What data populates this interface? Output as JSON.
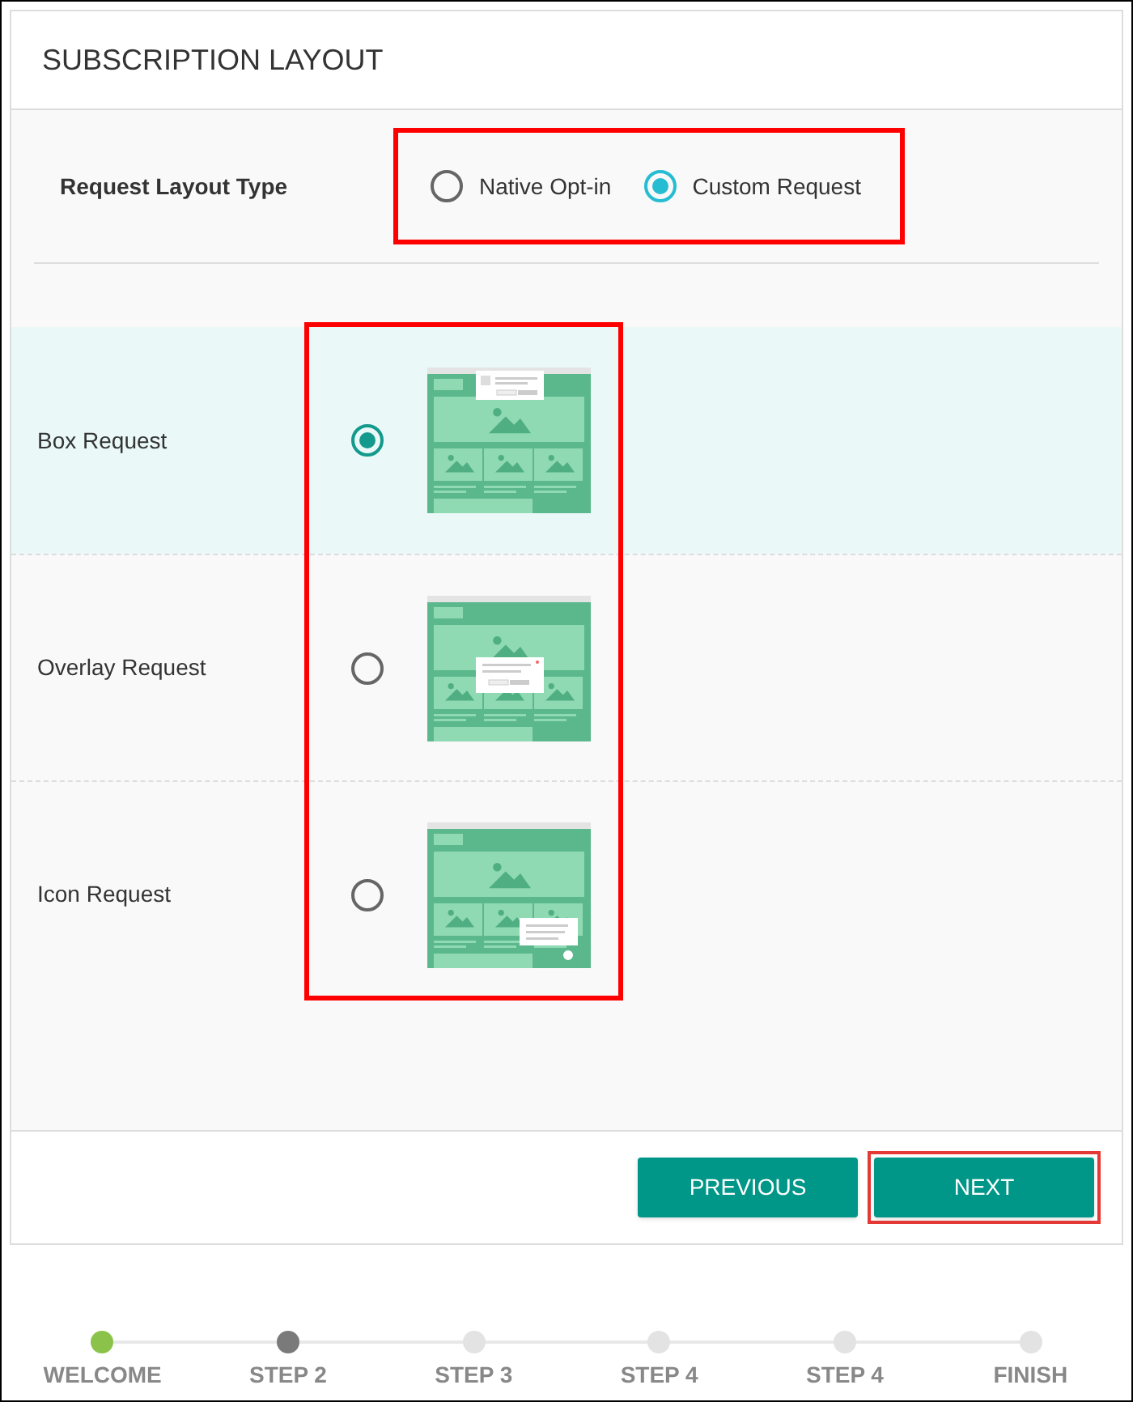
{
  "panel": {
    "title": "SUBSCRIPTION LAYOUT"
  },
  "layout_type": {
    "label": "Request Layout Type",
    "options": [
      {
        "label": "Native Opt-in",
        "selected": false
      },
      {
        "label": "Custom Request",
        "selected": true
      }
    ]
  },
  "requests": [
    {
      "label": "Box Request",
      "kind": "box",
      "selected": true
    },
    {
      "label": "Overlay Request",
      "kind": "overlay",
      "selected": false
    },
    {
      "label": "Icon Request",
      "kind": "icon",
      "selected": false
    }
  ],
  "buttons": [
    {
      "label": "PREVIOUS",
      "highlighted": false
    },
    {
      "label": "NEXT",
      "highlighted": true
    }
  ],
  "steps": [
    {
      "label": "WELCOME",
      "completed": true,
      "current": false
    },
    {
      "label": "STEP 2",
      "completed": false,
      "current": true
    },
    {
      "label": "STEP 3",
      "completed": false,
      "current": false
    },
    {
      "label": "STEP 4",
      "completed": false,
      "current": false
    },
    {
      "label": "STEP 4",
      "completed": false,
      "current": false
    },
    {
      "label": "FINISH",
      "completed": false,
      "current": false
    }
  ]
}
